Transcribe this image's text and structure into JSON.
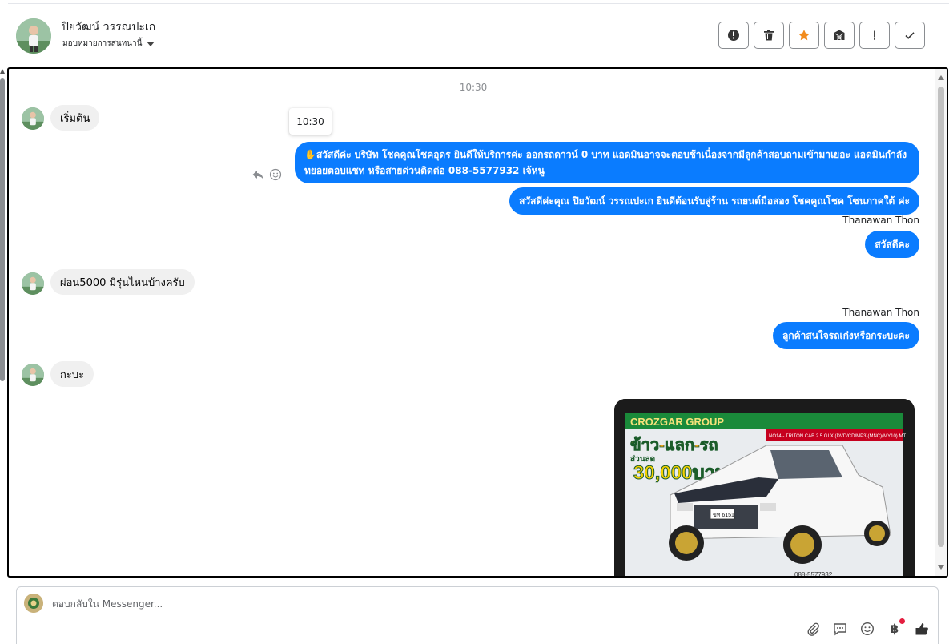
{
  "header": {
    "contact_name": "ปิยวัฒน์ วรรณปะเก",
    "assign_label": "มอบหมายการสนทนานี้",
    "actions": [
      {
        "name": "spam-button",
        "icon": "alert-circle-icon"
      },
      {
        "name": "delete-button",
        "icon": "trash-icon"
      },
      {
        "name": "star-button",
        "icon": "star-icon",
        "color": "#f28b1c"
      },
      {
        "name": "mark-unread-button",
        "icon": "envelope-x-icon"
      },
      {
        "name": "follow-up-button",
        "icon": "exclamation-icon"
      },
      {
        "name": "done-button",
        "icon": "check-icon"
      }
    ]
  },
  "chat": {
    "timestamp": "10:30",
    "tooltip_time": "10:30",
    "messages": [
      {
        "direction": "in",
        "text": "เริ่มต้น"
      },
      {
        "direction": "out",
        "text": "✋สวัสดีค่ะ บริษัท โชคคูณโชคอุดร ยินดีให้บริการค่ะ ออกรถดาวน์ 0 บาท แอดมินอาจจะตอบช้าเนื่องจากมีลูกค้าสอบถามเข้ามาเยอะ แอดมินกำลังทยอยตอบแชท หรือสายด่วนติดต่อ 088-5577932 เจ้หนู"
      },
      {
        "direction": "out",
        "text": "สวัสดีค่ะคุณ ปิยวัฒน์ วรรณปะเก ยินดีต้อนรับสู่ร้าน รถยนต์มือสอง โชคคูณโชค โซนภาคใต้ ค่ะ"
      },
      {
        "direction": "out",
        "sender": "Thanawan Thon",
        "text": "สวัสดีคะ"
      },
      {
        "direction": "in",
        "text": "ผ่อน5000 มีรุ่นไหนบ้างครับ"
      },
      {
        "direction": "out",
        "sender": "Thanawan Thon",
        "text": "ลูกค้าสนใจรถเก๋งหรือกระบะคะ"
      },
      {
        "direction": "in",
        "text": "กะบะ"
      }
    ],
    "image": {
      "banner_top": "CROZGAR GROUP",
      "model_text": "NO14 - TRITON CAB 2.5 GLX (DVD/CD/MP3)(MNC)(MY10) MT",
      "promo_line1": "ข้าว-แลก-รถ",
      "promo_line2": "ส่วนลด",
      "promo_amount": "30,000บาท",
      "plate": "ขท 6151",
      "phone": "088-5577932"
    }
  },
  "composer": {
    "placeholder": "ตอบกลับใน Messenger...",
    "currency_symbol": "฿"
  },
  "colors": {
    "accent": "#0a7cff",
    "star": "#f28b1c",
    "notify": "#e41e3f"
  }
}
